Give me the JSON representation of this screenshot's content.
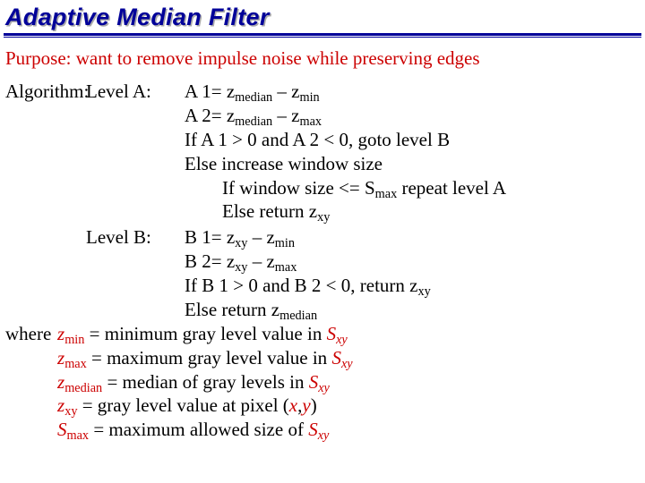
{
  "title": "Adaptive Median Filter",
  "purpose": "Purpose: want to remove impulse noise while preserving edges",
  "algoLabel": "Algorithm:",
  "levelA": {
    "label": "Level A:"
  },
  "levelB": {
    "label": "Level B:"
  },
  "whereLabel": "where",
  "linesA": {
    "a1_pre": "A 1= z",
    "a1_s1": "median",
    "a1_mid": " – z",
    "a1_s2": "min",
    "a2_pre": "A 2= z",
    "a2_s1": "median",
    "a2_mid": " – z",
    "a2_s2": "max",
    "a3": "If A 1 > 0 and A 2 < 0, goto level B",
    "a4": "Else increase window size",
    "a5_pre": "If window size <= S",
    "a5_s": "max",
    "a5_post": " repeat level A",
    "a6_pre": "Else return z",
    "a6_s": "xy"
  },
  "linesB": {
    "b1_pre": "B 1= z",
    "b1_s1": "xy",
    "b1_mid": " – z",
    "b1_s2": "min",
    "b2_pre": "B 2= z",
    "b2_s1": "xy",
    "b2_mid": " – z",
    "b2_s2": "max",
    "b3_pre": "If B 1 > 0 and B 2 < 0, return z",
    "b3_s": "xy",
    "b4_pre": "Else return z",
    "b4_s": "median"
  },
  "where": {
    "w1_z": "z",
    "w1_sub": "min",
    "w1_txt": " = minimum gray level value in ",
    "w1_S": "S",
    "w1_Ssub": "xy",
    "w2_z": "z",
    "w2_sub": "max",
    "w2_txt": " = maximum gray level value in ",
    "w2_S": "S",
    "w2_Ssub": "xy",
    "w3_z": "z",
    "w3_sub": "median",
    "w3_txt": " = median of gray levels in ",
    "w3_S": "S",
    "w3_Ssub": "xy",
    "w4_z": "z",
    "w4_sub": "xy",
    "w4_txt": " = gray level value at pixel (",
    "w4_x": "x",
    "w4_comma": ",",
    "w4_y": "y",
    "w4_close": ")",
    "w5_S": "S",
    "w5_sub": "max",
    "w5_txt": " = maximum allowed size of ",
    "w5_S2": "S",
    "w5_S2sub": "xy"
  }
}
